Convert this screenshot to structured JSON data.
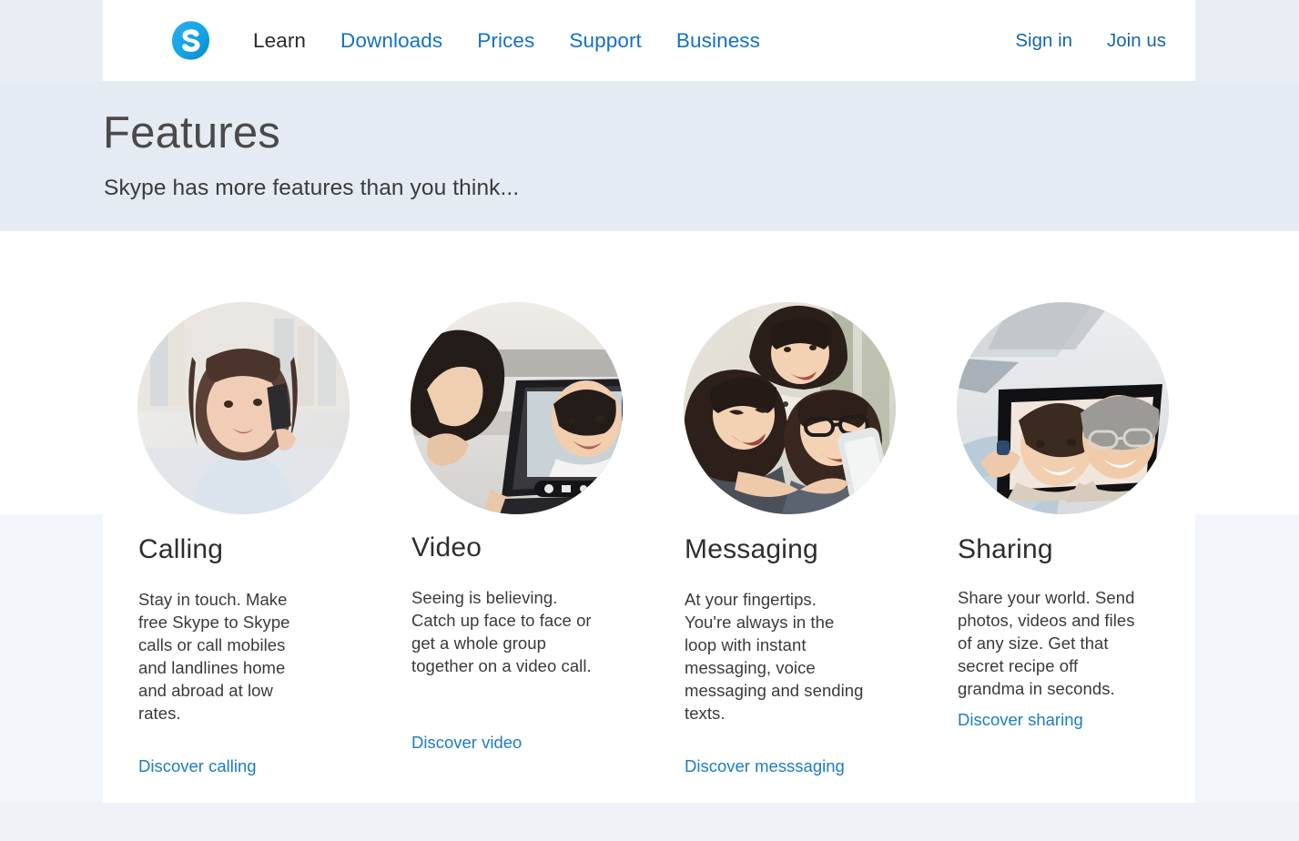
{
  "header": {
    "logo_icon": "skype-logo-icon",
    "brand_color": "#00AFF0",
    "nav": [
      {
        "label": "Learn",
        "active": true
      },
      {
        "label": "Downloads",
        "active": false
      },
      {
        "label": "Prices",
        "active": false
      },
      {
        "label": "Support",
        "active": false
      },
      {
        "label": "Business",
        "active": false
      }
    ],
    "account": [
      {
        "label": "Sign in"
      },
      {
        "label": "Join us"
      }
    ],
    "link_color": "#1271c4",
    "account_link_color": "#1565a8"
  },
  "hero": {
    "title": "Features",
    "subtitle": "Skype has more features than you think...",
    "background": "#e5ebf2"
  },
  "features": [
    {
      "title": "Calling",
      "body": "Stay in touch. Make free Skype to Skype calls or call mobiles and landlines home and abroad at low rates.",
      "cta": "Discover calling",
      "photo_name": "woman-on-phone-photo",
      "photo_alt": "Smiling woman holding a mobile phone to her ear in front of a bookshelf"
    },
    {
      "title": "Video",
      "body": "Seeing is believing. Catch up face to face or get a whole group together on a video call.",
      "cta": "Discover video",
      "photo_name": "video-call-laptop-photo",
      "photo_alt": "Woman looking at a laptop screen showing a smiling man on a video call"
    },
    {
      "title": "Messaging",
      "body": "At your fingertips. You're always in the loop with instant messaging, voice messaging and sending texts.",
      "cta": "Discover messsaging",
      "photo_name": "friends-with-smartphone-photo",
      "photo_alt": "Three friends laughing while looking at a smartphone outdoors"
    },
    {
      "title": "Sharing",
      "body": "Share your world. Send photos, videos and files of any size. Get that secret recipe off grandma in seconds.",
      "cta": "Discover sharing",
      "photo_name": "tablet-family-photo-photo",
      "photo_alt": "Hand holding a tablet displaying a photo of two smiling older women"
    }
  ],
  "cta_color": "#1b7cc4"
}
